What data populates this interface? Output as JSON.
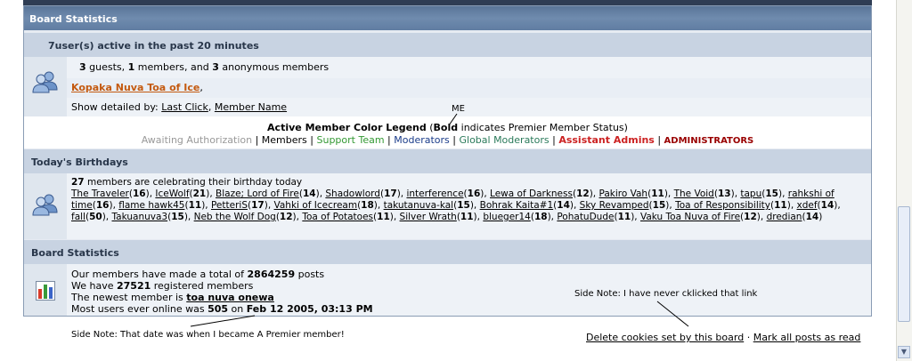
{
  "board": {
    "title": "Board Statistics"
  },
  "active": {
    "heading": "7user(s) active in the past 20 minutes",
    "guests": "3",
    "guests_label": " guests, ",
    "members": "1",
    "members_label": " members, and ",
    "anon": "3",
    "anon_label": " anonymous members",
    "member_link": "Kopaka Nuva Toa of Ice",
    "after_link": ",",
    "show_label": "Show detailed by: ",
    "sort_last_click": "Last Click",
    "sort_sep": ", ",
    "sort_member_name": "Member Name"
  },
  "legend": {
    "title": "Active Member Color Legend",
    "open": " (",
    "bold_word": "Bold",
    "rest": " indicates Premier Member Status)",
    "sep": " | ",
    "groups": [
      {
        "label": "Awaiting Authorization",
        "color": "#999999"
      },
      {
        "label": "Members",
        "color": "#000000"
      },
      {
        "label": "Support Team",
        "color": "#339933"
      },
      {
        "label": "Moderators",
        "color": "#1a3c8a"
      },
      {
        "label": "Global Moderators",
        "color": "#2a7a5a"
      },
      {
        "label": "Assistant Admins",
        "color": "#cc2222"
      },
      {
        "label": "ADMINISTRATORS",
        "color": "#990000"
      }
    ]
  },
  "birthdays": {
    "heading": "Today's Birthdays",
    "count": "27",
    "count_label": " members are celebrating their birthday today",
    "people": [
      {
        "name": "The Traveler",
        "age": "16"
      },
      {
        "name": "IceWolf",
        "age": "21"
      },
      {
        "name": "Blaze; Lord of Fire",
        "age": "14"
      },
      {
        "name": "Shadowlord",
        "age": "17"
      },
      {
        "name": "interference",
        "age": "16"
      },
      {
        "name": "Lewa of Darkness",
        "age": "12"
      },
      {
        "name": "Pakiro Vah",
        "age": "11"
      },
      {
        "name": "The Void",
        "age": "13"
      },
      {
        "name": "tapu",
        "age": "15"
      },
      {
        "name": "rahkshi of time",
        "age": "16"
      },
      {
        "name": "flame hawk45",
        "age": "11"
      },
      {
        "name": "PetteriS",
        "age": "17"
      },
      {
        "name": "Vahki of Icecream",
        "age": "18"
      },
      {
        "name": "takutanuva-kal",
        "age": "15"
      },
      {
        "name": "Bohrak Kaita#1",
        "age": "14"
      },
      {
        "name": "Sky Revamped",
        "age": "15"
      },
      {
        "name": "Toa of Responsibility",
        "age": "11"
      },
      {
        "name": "xdef",
        "age": "14"
      },
      {
        "name": "fall",
        "age": "50"
      },
      {
        "name": "Takuanuva3",
        "age": "15"
      },
      {
        "name": "Neb the Wolf Dog",
        "age": "12"
      },
      {
        "name": "Toa of Potatoes",
        "age": "11"
      },
      {
        "name": "Silver Wrath",
        "age": "11"
      },
      {
        "name": "blueger14",
        "age": "18"
      },
      {
        "name": "PohatuDude",
        "age": "11"
      },
      {
        "name": "Vaku Toa Nuva of Fire",
        "age": "12"
      },
      {
        "name": "dredian",
        "age": "14"
      }
    ]
  },
  "stats": {
    "heading": "Board Statistics",
    "posts_pre": "Our members have made a total of ",
    "posts": "2864259",
    "posts_post": " posts",
    "reg_pre": "We have ",
    "reg": "27521",
    "reg_post": " registered members",
    "newest_pre": "The newest member is ",
    "newest": "toa nuva onewa",
    "online_pre": "Most users ever online was ",
    "online_count": "505",
    "online_mid": " on ",
    "online_date": "Feb 12 2005, 03:13 PM"
  },
  "footer": {
    "delete_cookies": "Delete cookies set by this board",
    "dot": " · ",
    "mark_read": "Mark all posts as read"
  },
  "notes": {
    "me": "ME",
    "link_note": "Side Note: I have never cklicked that link",
    "date_note": "Side Note: That date was when I became A Premier member!"
  }
}
